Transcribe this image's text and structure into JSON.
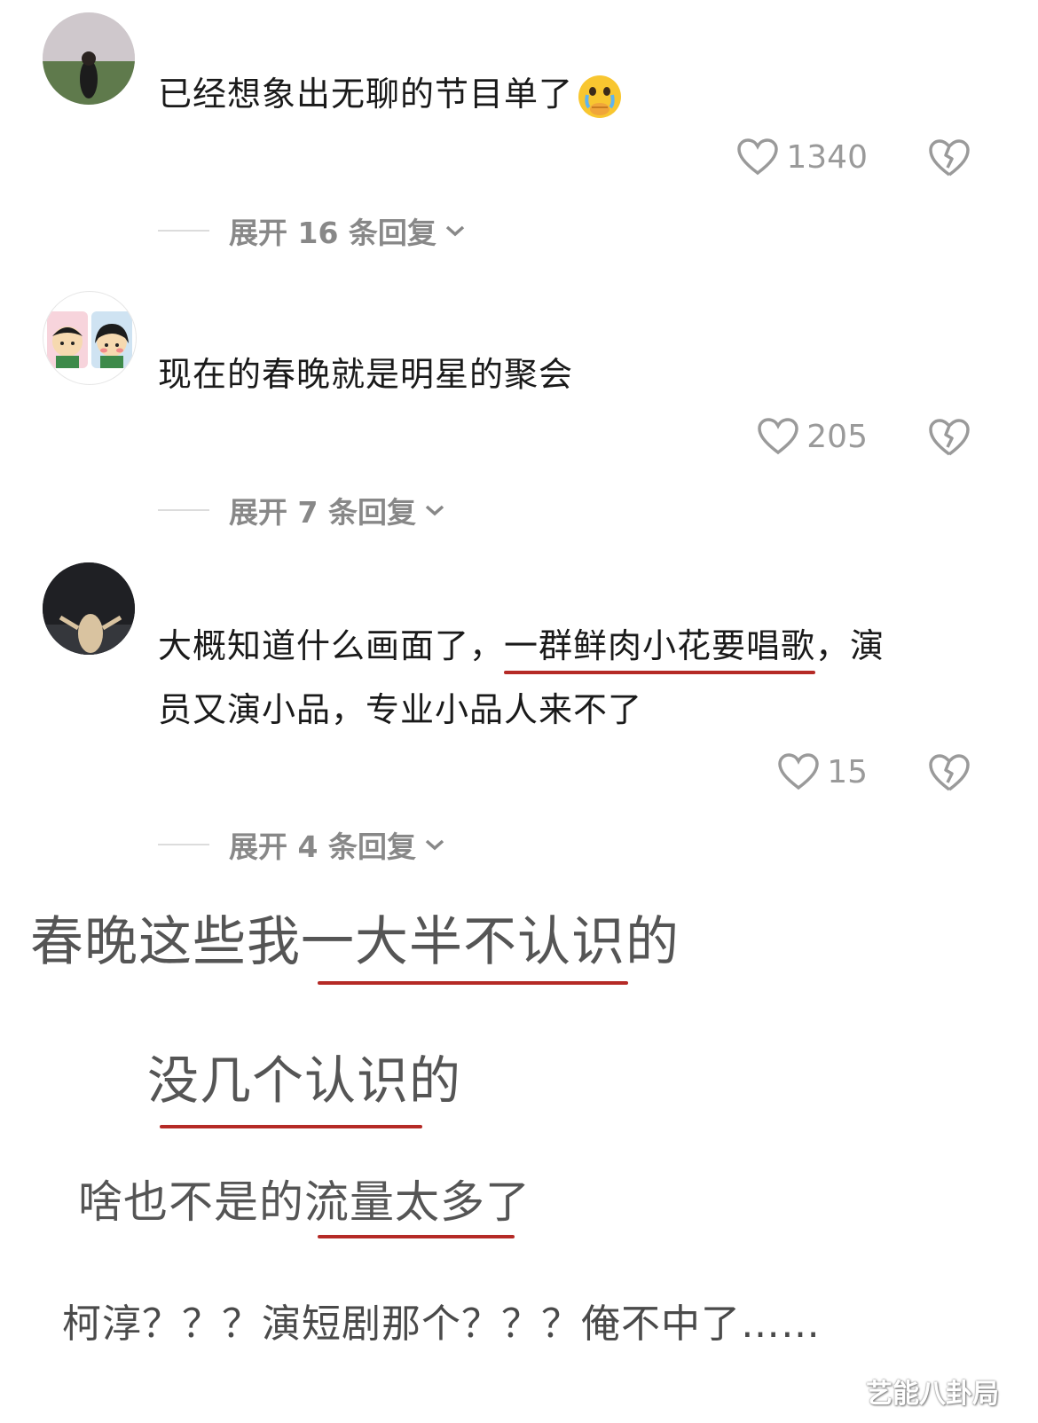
{
  "comments": [
    {
      "text": "已经想象出无聊的节目单了",
      "emoji": "crying-face-emoji",
      "likes": "1340",
      "expand": "展开 16 条回复"
    },
    {
      "text": "现在的春晚就是明星的聚会",
      "likes": "205",
      "expand": "展开 7 条回复"
    },
    {
      "text_pre": "大概知道什么画面了，",
      "text_highlight": "一群鲜肉小花要唱歌",
      "text_post": "，演",
      "text_line2": "员又演小品，专业小品人来不了",
      "likes": "15",
      "expand": "展开 4 条回复"
    }
  ],
  "snippets": [
    "春晚这些我一大半不认识的",
    "没几个认识的",
    "啥也不是的流量太多了",
    "柯淳？？？演短剧那个？？？俺不中了……"
  ],
  "watermark": "艺能八卦局",
  "colors": {
    "underline": "#b52a26",
    "meta_text": "#9a9a9a"
  }
}
